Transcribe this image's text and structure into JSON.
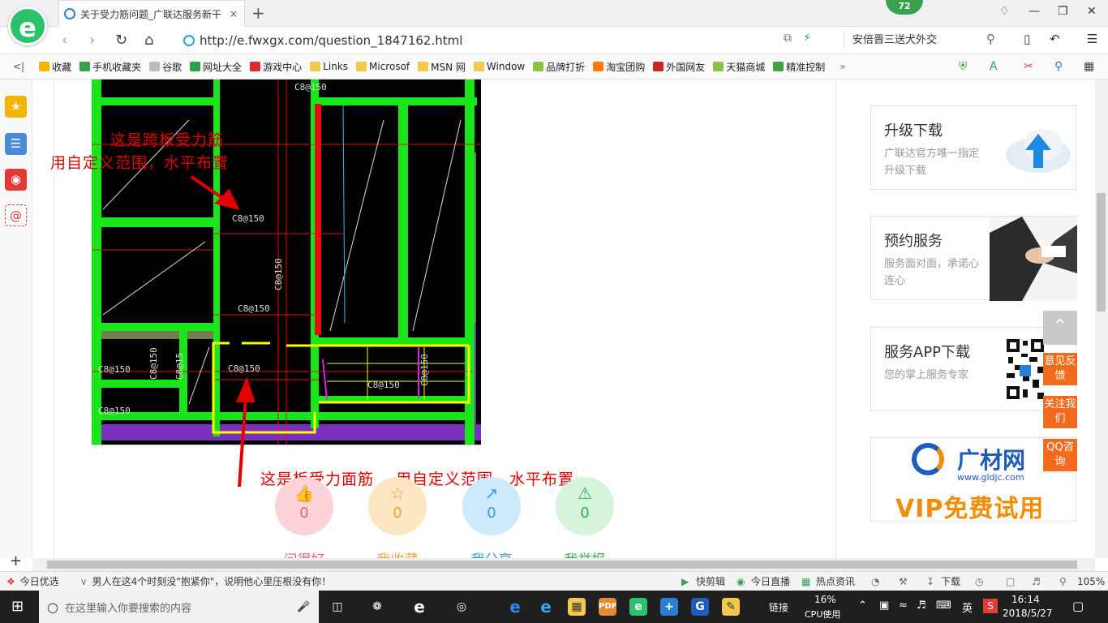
{
  "browser": {
    "logo_glyph": "e",
    "tab_title": "关于受力筋问题_广联达服务新干",
    "close_glyph": "×",
    "newtab_glyph": "+",
    "badge": "72",
    "url": "http://e.fwxgx.com/question_1847162.html",
    "search_text": "安倍晋三送犬外交",
    "bookmarks": [
      {
        "label": "收藏",
        "color": "#f5b400"
      },
      {
        "label": "手机收藏夹",
        "color": "#3aa04c"
      },
      {
        "label": "谷歌",
        "color": "#999999"
      },
      {
        "label": "网址大全",
        "color": "#2aa04c"
      },
      {
        "label": "游戏中心",
        "color": "#d32f2f"
      },
      {
        "label": "Links",
        "color": "#f2c94c"
      },
      {
        "label": "Microsof",
        "color": "#f2c94c"
      },
      {
        "label": "MSN 网",
        "color": "#f2c94c"
      },
      {
        "label": "Window",
        "color": "#f2c94c"
      },
      {
        "label": "品牌打折",
        "color": "#8bc34a"
      },
      {
        "label": "淘宝团购",
        "color": "#ff7a00"
      },
      {
        "label": "外国网友",
        "color": "#c62828"
      },
      {
        "label": "天猫商城",
        "color": "#8bc34a"
      },
      {
        "label": "精准控制",
        "color": "#43a047"
      }
    ]
  },
  "cad": {
    "labels": [
      "C8@150",
      "C8@150",
      "C8@150",
      "C8@150",
      "C8@150",
      "C8@150",
      "C8@150",
      "C8@150",
      "C8@15",
      "C8@150",
      "C8@150"
    ]
  },
  "annotations": {
    "a1": "这是跨板受力筋",
    "a2": "用自定义范围，水平布置",
    "a3": "这是板受力面筋 ，用自定义范围，水平布置"
  },
  "actions": [
    {
      "icon": "👍",
      "count": "0",
      "label": "问得好",
      "bg": "#fbd3d8",
      "fg": "#e0647a"
    },
    {
      "icon": "☆",
      "count": "0",
      "label": "我收藏",
      "bg": "#fde7c2",
      "fg": "#e8a33a"
    },
    {
      "icon": "↗",
      "count": "0",
      "label": "我分享",
      "bg": "#cde9fb",
      "fg": "#3a9ae0"
    },
    {
      "icon": "⚠",
      "count": "0",
      "label": "我举报",
      "bg": "#d6f3dc",
      "fg": "#3aaa58"
    }
  ],
  "cards": [
    {
      "title": "升级下载",
      "desc": "广联达官方唯一指定升级下载"
    },
    {
      "title": "预约服务",
      "desc": "服务面对面，承诺心连心"
    },
    {
      "title": "服务APP下载",
      "desc": "您的掌上服务专家"
    }
  ],
  "ad": {
    "brand": "广材网",
    "url": "www.gldjc.com",
    "slogan": "VIP免费试用"
  },
  "float_btns": [
    "意见反馈",
    "关注我们",
    "QQ咨询"
  ],
  "status": {
    "today_pick": "今日优选",
    "news": "男人在这4个时刻没\"抱紧你\"，说明他心里压根没有你！",
    "items": [
      "快剪辑",
      "今日直播",
      "热点资讯",
      "下载"
    ],
    "zoom": "105%"
  },
  "taskbar": {
    "search_placeholder": "在这里输入你要搜索的内容",
    "link": "链接",
    "cpu": "16%",
    "cpu_label": "CPU使用",
    "ime": "英",
    "time": "16:14",
    "date": "2018/5/27"
  }
}
